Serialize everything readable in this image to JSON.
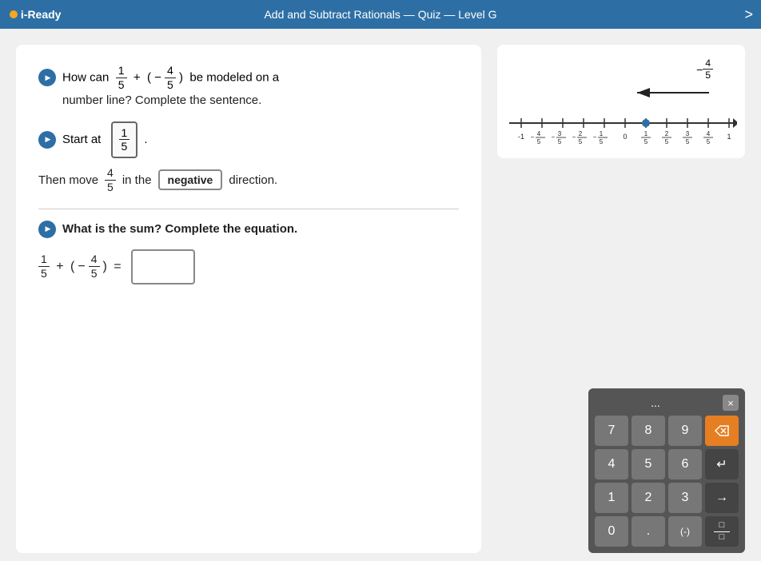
{
  "header": {
    "logo": "i-Ready",
    "title": "Add and Subtract Rationals — Quiz — Level G",
    "arrow": ">"
  },
  "question1": {
    "sound_label": "sound",
    "text_before": "How can",
    "fraction1_num": "1",
    "fraction1_den": "5",
    "plus": "+",
    "paren_open": "(",
    "neg": "−",
    "fraction2_num": "4",
    "fraction2_den": "5",
    "paren_close": ")",
    "text_after": "be modeled on a number line? Complete the sentence."
  },
  "start_at": {
    "label": "Start at",
    "sound_label": "sound",
    "frac_num": "1",
    "frac_den": "5",
    "dot": "."
  },
  "then_move": {
    "text1": "Then move",
    "frac_num": "4",
    "frac_den": "5",
    "text2": "in the",
    "answer_box": "negative",
    "text3": "direction."
  },
  "question2": {
    "sound_label": "sound",
    "text": "What is the sum? Complete the equation.",
    "eq_frac1_num": "1",
    "eq_frac1_den": "5",
    "eq_plus": "+",
    "eq_paren_open": "(",
    "eq_neg": "−",
    "eq_frac2_num": "4",
    "eq_frac2_den": "5",
    "eq_paren_close": ")",
    "eq_equals": "=",
    "answer_value": ""
  },
  "number_line": {
    "arrow_label_neg": "−",
    "frac_num": "4",
    "frac_den": "5",
    "tick_labels": [
      "-1",
      "-4/5",
      "-3/5",
      "-2/5",
      "-1/5",
      "0",
      "1/5",
      "2/5",
      "3/5",
      "4/5",
      "1"
    ],
    "display_labels": [
      "-1",
      "−4/5",
      "−3/5",
      "−2/5",
      "−1/5",
      "0",
      "1/5",
      "2/5",
      "3/5",
      "4/5",
      "1"
    ]
  },
  "keypad": {
    "dots": "...",
    "close_label": "×",
    "buttons": [
      {
        "label": "7",
        "row": 0,
        "col": 0
      },
      {
        "label": "8",
        "row": 0,
        "col": 1
      },
      {
        "label": "9",
        "row": 0,
        "col": 2
      },
      {
        "label": "⌫",
        "row": 0,
        "col": 3,
        "type": "orange"
      },
      {
        "label": "4",
        "row": 1,
        "col": 0
      },
      {
        "label": "5",
        "row": 1,
        "col": 1
      },
      {
        "label": "6",
        "row": 1,
        "col": 2
      },
      {
        "label": "→",
        "row": 1,
        "col": 3,
        "type": "dark"
      },
      {
        "label": "1",
        "row": 2,
        "col": 0
      },
      {
        "label": "2",
        "row": 2,
        "col": 1
      },
      {
        "label": "3",
        "row": 2,
        "col": 2
      },
      {
        "label": "→",
        "row": 2,
        "col": 3,
        "type": "dark"
      },
      {
        "label": "0",
        "row": 3,
        "col": 0
      },
      {
        "label": ".",
        "row": 3,
        "col": 1
      },
      {
        "label": "(-)",
        "row": 3,
        "col": 2,
        "type": "special"
      },
      {
        "label": "frac",
        "row": 3,
        "col": 3,
        "type": "frac"
      }
    ]
  }
}
